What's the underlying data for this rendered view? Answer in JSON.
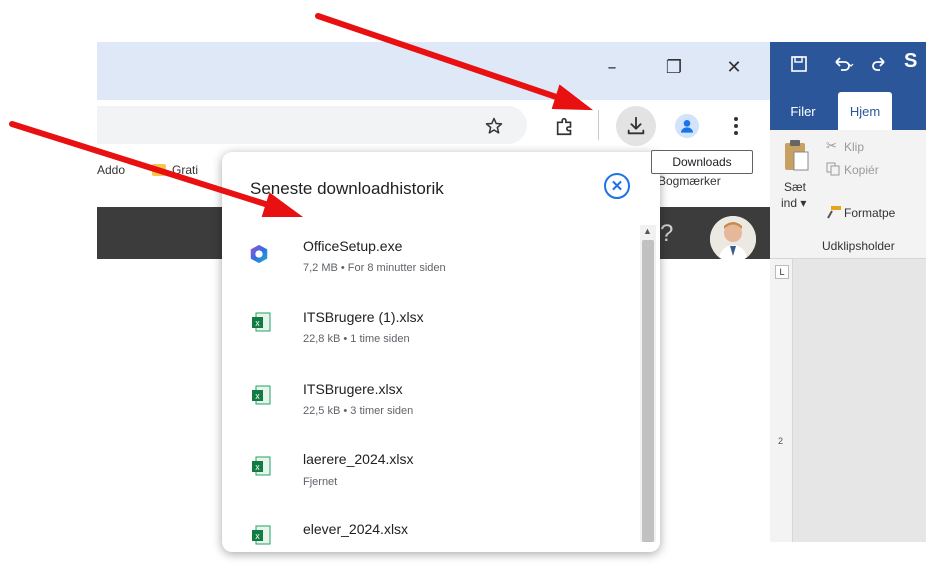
{
  "chrome": {
    "window_controls": {
      "minimize": "–",
      "restore": "❐",
      "close": "✕"
    },
    "bookmarks": [
      {
        "label": "Addo"
      },
      {
        "label": "Grati"
      }
    ],
    "bookmarks_right_label": "Bogmærker",
    "help_glyph": "?",
    "downloads_tooltip": "Downloads",
    "accent_color": "#1a73e8"
  },
  "downloads": {
    "title": "Seneste downloadhistorik",
    "items": [
      {
        "name": "OfficeSetup.exe",
        "meta": "7,2 MB • For 8 minutter siden",
        "icon": "office-icon"
      },
      {
        "name": "ITSBrugere (1).xlsx",
        "meta": "22,8 kB • 1 time siden",
        "icon": "excel-file-icon"
      },
      {
        "name": "ITSBrugere.xlsx",
        "meta": "22,5 kB • 3 timer siden",
        "icon": "excel-file-icon"
      },
      {
        "name": "laerere_2024.xlsx",
        "meta": "Fjernet",
        "icon": "excel-file-icon"
      },
      {
        "name": "elever_2024.xlsx",
        "meta": "",
        "icon": "excel-file-icon"
      }
    ]
  },
  "word": {
    "tabs": [
      "Filer",
      "Hjem"
    ],
    "active_tab": "Hjem",
    "ribbon": {
      "paste_label_1": "Sæt",
      "paste_label_2": "ind ▾",
      "cut": "Klip",
      "copy": "Kopiér",
      "format_painter": "Formatpe",
      "group_label": "Udklipsholder"
    },
    "ruler_corner": "L",
    "ruler_mark": "2",
    "brand_color": "#2b579a"
  },
  "annotations": {
    "arrow_color": "#e81010"
  }
}
